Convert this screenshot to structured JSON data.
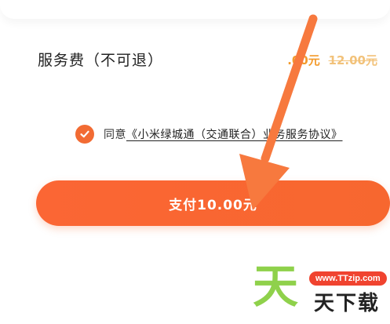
{
  "fee": {
    "label": "服务费（不可退）",
    "current_price": ".00元",
    "original_price": "12.00元"
  },
  "agreement": {
    "prefix": "同意",
    "link_text": "《小米绿城通（交通联合）业务服务协议》",
    "checked": true
  },
  "pay_button": {
    "label": "支付10.00元"
  },
  "watermark": {
    "big_char": "天",
    "url": "www.TTzip.com",
    "small_text": "天下载"
  },
  "colors": {
    "accent": "#f7672f",
    "price": "#f39a2b",
    "watermark_green": "#8fd14b",
    "watermark_red": "#f0432f"
  }
}
